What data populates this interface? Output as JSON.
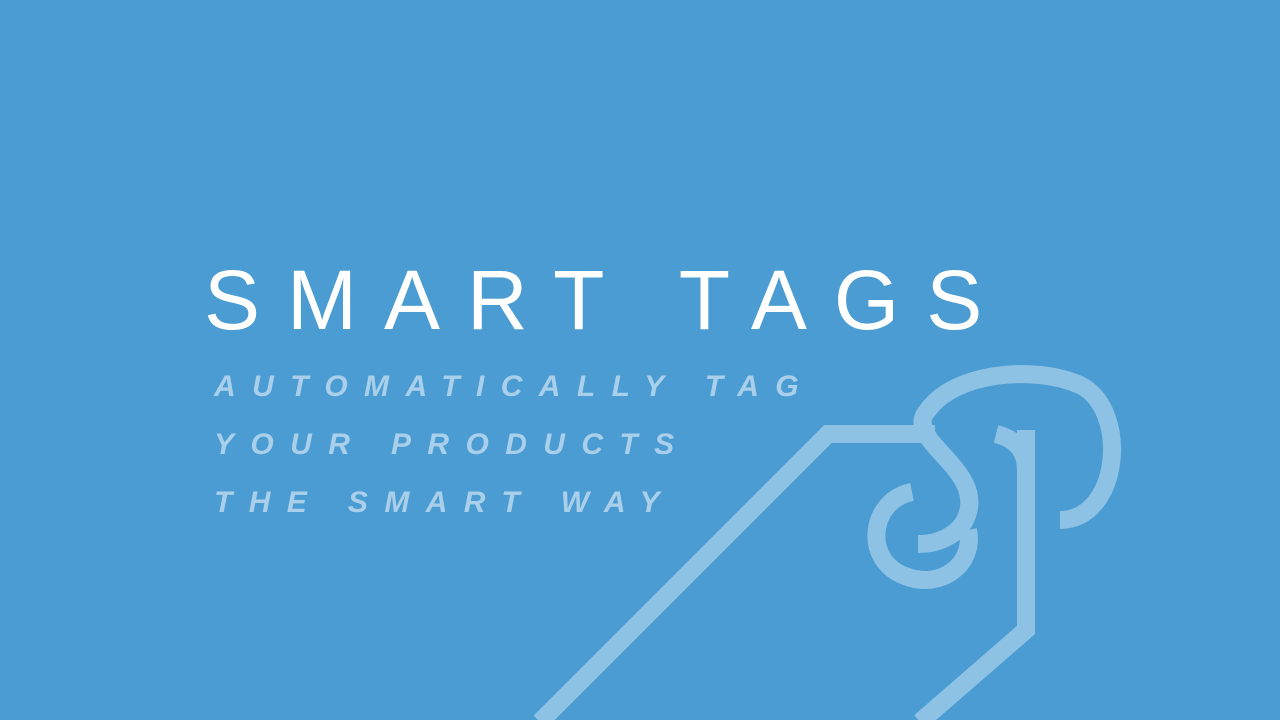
{
  "slide": {
    "title": "SMART TAGS",
    "tagline": [
      "AUTOMATICALLY TAG",
      "YOUR PRODUCTS",
      "THE SMART WAY"
    ]
  },
  "colors": {
    "background": "#4a9cd2",
    "title": "#ffffff",
    "tagline": "#a9cfea",
    "tag_outline": "#8ec2e5"
  },
  "icons": [
    "price-tag-icon"
  ]
}
